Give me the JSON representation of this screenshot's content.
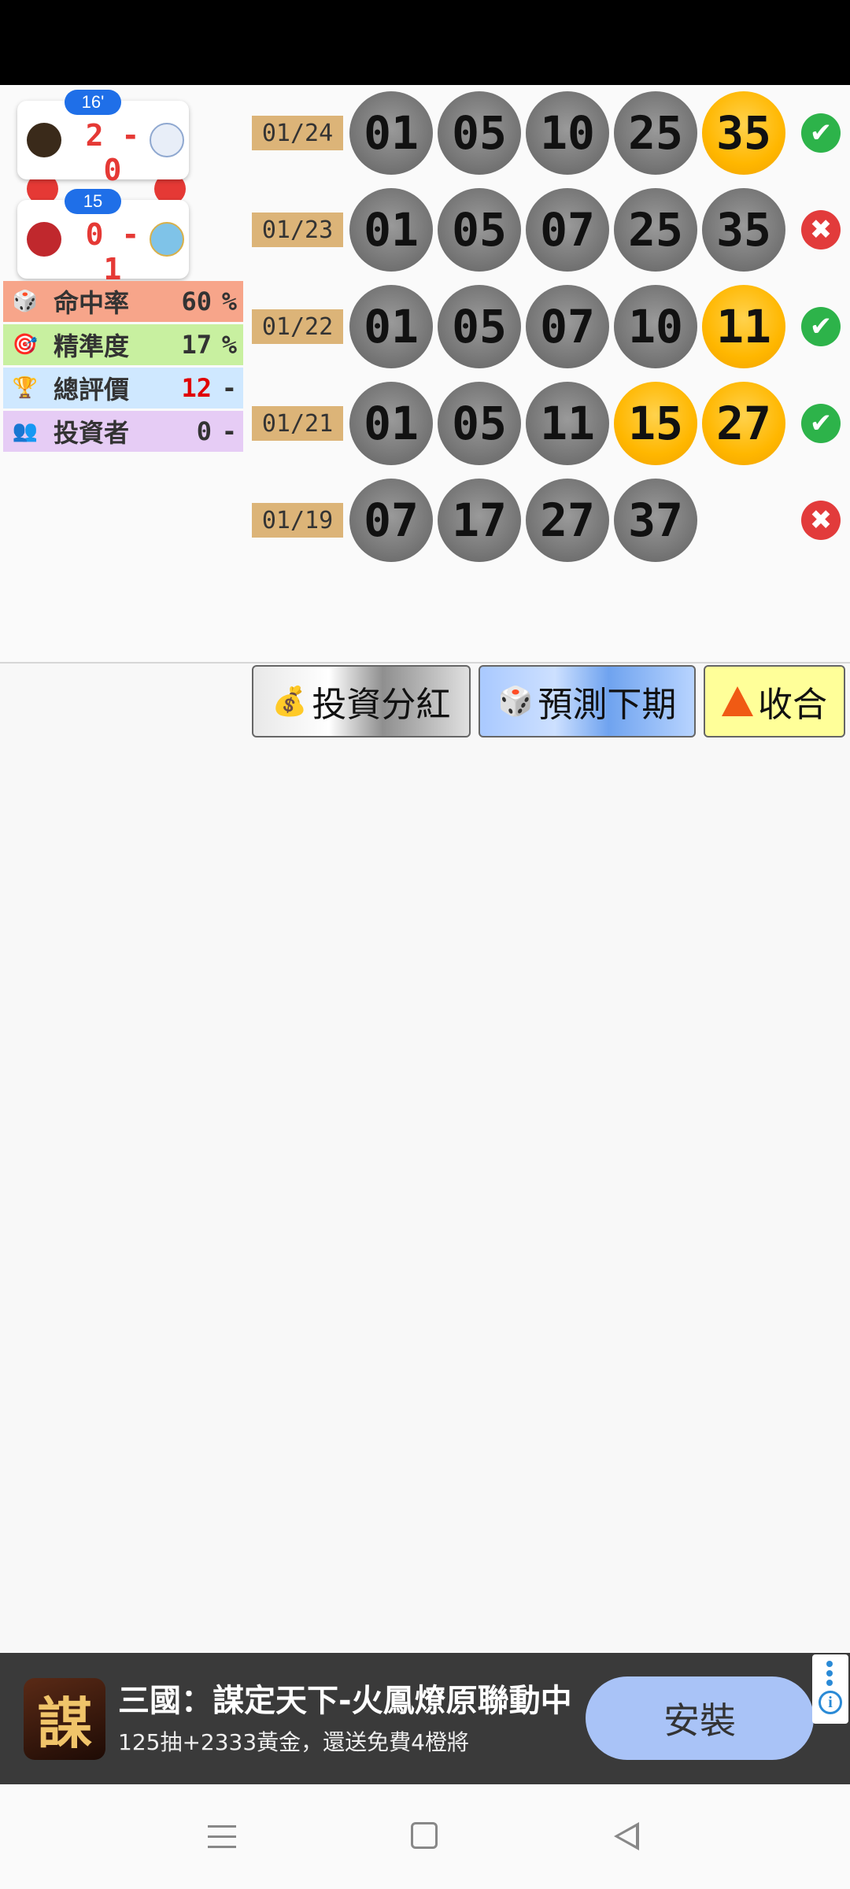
{
  "matches": [
    {
      "minute": "16'",
      "score": "2 - 0"
    },
    {
      "minute": "15",
      "score": "0 - 1"
    }
  ],
  "stats": [
    {
      "label": "命中率",
      "value": "60",
      "unit": "%",
      "icon": "dice-icon",
      "bg": "#f7a58a",
      "value_color": "#333333"
    },
    {
      "label": "精準度",
      "value": "17",
      "unit": "%",
      "icon": "target-icon",
      "bg": "#c8f0a0",
      "value_color": "#333333"
    },
    {
      "label": "總評價",
      "value": "12",
      "unit": "-",
      "icon": "trophy-icon",
      "bg": "#cfe8ff",
      "value_color": "#e00000"
    },
    {
      "label": "投資者",
      "value": "0",
      "unit": "-",
      "icon": "investors-icon",
      "bg": "#e6ccf5",
      "value_color": "#333333"
    }
  ],
  "draws": [
    {
      "date": "01/24",
      "numbers": [
        {
          "n": "01",
          "hit": false
        },
        {
          "n": "05",
          "hit": false
        },
        {
          "n": "10",
          "hit": false
        },
        {
          "n": "25",
          "hit": false
        },
        {
          "n": "35",
          "hit": true
        }
      ],
      "result": "correct"
    },
    {
      "date": "01/23",
      "numbers": [
        {
          "n": "01",
          "hit": false
        },
        {
          "n": "05",
          "hit": false
        },
        {
          "n": "07",
          "hit": false
        },
        {
          "n": "25",
          "hit": false
        },
        {
          "n": "35",
          "hit": false
        }
      ],
      "result": "wrong"
    },
    {
      "date": "01/22",
      "numbers": [
        {
          "n": "01",
          "hit": false
        },
        {
          "n": "05",
          "hit": false
        },
        {
          "n": "07",
          "hit": false
        },
        {
          "n": "10",
          "hit": false
        },
        {
          "n": "11",
          "hit": true
        }
      ],
      "result": "correct"
    },
    {
      "date": "01/21",
      "numbers": [
        {
          "n": "01",
          "hit": false
        },
        {
          "n": "05",
          "hit": false
        },
        {
          "n": "11",
          "hit": false
        },
        {
          "n": "15",
          "hit": true
        },
        {
          "n": "27",
          "hit": true
        }
      ],
      "result": "correct"
    },
    {
      "date": "01/19",
      "numbers": [
        {
          "n": "07",
          "hit": false
        },
        {
          "n": "17",
          "hit": false
        },
        {
          "n": "27",
          "hit": false
        },
        {
          "n": "37",
          "hit": false
        }
      ],
      "result": "wrong"
    }
  ],
  "buttons": {
    "invest": "投資分紅",
    "predict": "預測下期",
    "collapse": "收合"
  },
  "ad": {
    "icon_text": "謀",
    "title": "三國：謀定天下-火鳳燎原聯動中",
    "subtitle": "125抽+2333黃金，還送免費4橙將",
    "install": "安裝"
  }
}
